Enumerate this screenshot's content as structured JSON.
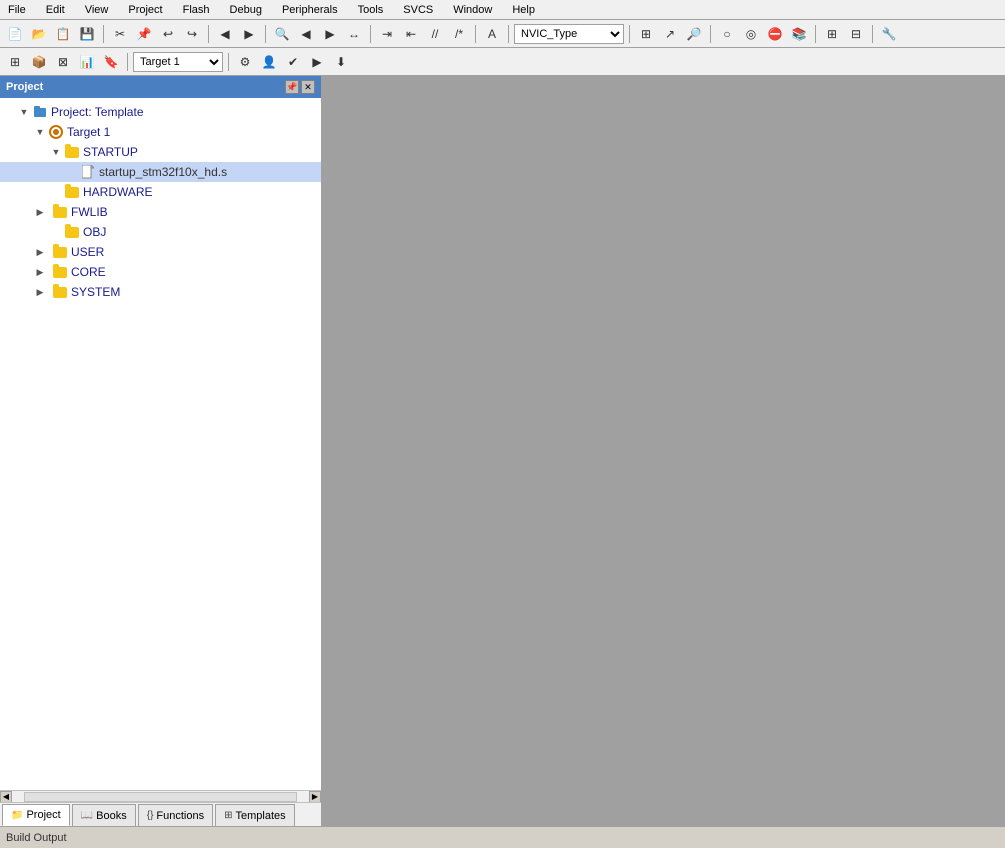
{
  "menubar": {
    "items": [
      "File",
      "Edit",
      "View",
      "Project",
      "Flash",
      "Debug",
      "Peripherals",
      "Tools",
      "SVCS",
      "Window",
      "Help"
    ]
  },
  "toolbar1": {
    "combo_target": "NVIC_Type"
  },
  "toolbar2": {
    "combo_target2": "Target 1"
  },
  "panel": {
    "title": "Project",
    "title_buttons": [
      "📌",
      "✕"
    ]
  },
  "tree": {
    "root": {
      "label": "Project: Template",
      "expanded": true,
      "children": [
        {
          "label": "Target 1",
          "type": "target",
          "expanded": true,
          "children": [
            {
              "label": "STARTUP",
              "type": "folder",
              "expanded": true,
              "children": [
                {
                  "label": "startup_stm32f10x_hd.s",
                  "type": "file",
                  "selected": true
                }
              ]
            },
            {
              "label": "HARDWARE",
              "type": "folder",
              "expanded": false
            },
            {
              "label": "FWLIB",
              "type": "folder",
              "expanded": false,
              "has_toggle": true
            },
            {
              "label": "OBJ",
              "type": "folder",
              "expanded": false
            },
            {
              "label": "USER",
              "type": "folder",
              "expanded": false,
              "has_toggle": true
            },
            {
              "label": "CORE",
              "type": "folder",
              "expanded": false,
              "has_toggle": true
            },
            {
              "label": "SYSTEM",
              "type": "folder",
              "expanded": false,
              "has_toggle": true
            }
          ]
        }
      ]
    }
  },
  "bottom_tabs": [
    {
      "id": "project",
      "label": "Project",
      "icon": "📁",
      "active": true
    },
    {
      "id": "books",
      "label": "Books",
      "icon": "📖"
    },
    {
      "id": "functions",
      "label": "Functions",
      "icon": "{}"
    },
    {
      "id": "templates",
      "label": "Templates",
      "icon": "⊞"
    }
  ],
  "statusbar": {
    "label": "Build Output"
  }
}
